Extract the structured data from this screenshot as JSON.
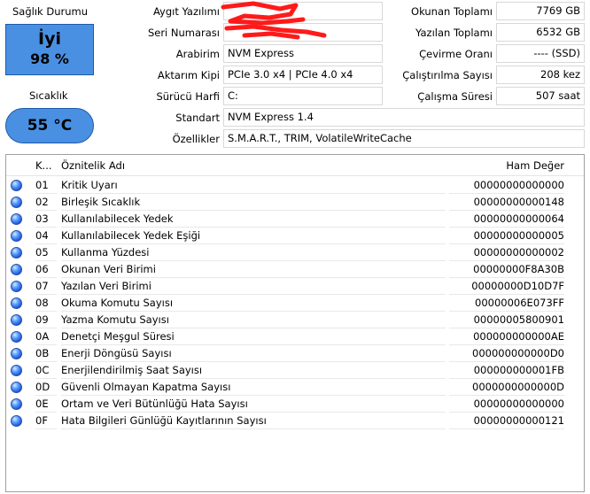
{
  "status": {
    "health_label": "Sağlık Durumu",
    "health_status": "İyi",
    "health_percent": "98 %",
    "temperature_label": "Sıcaklık",
    "temperature_value": "55 °C"
  },
  "info": {
    "firmware_label": "Aygıt Yazılımı",
    "serial_label": "Seri Numarası",
    "interface_label": "Arabirim",
    "interface_value": "NVM Express",
    "transfer_label": "Aktarım Kipi",
    "transfer_value": "PCIe 3.0 x4 | PCIe 4.0 x4",
    "drive_letter_label": "Sürücü Harfi",
    "drive_letter_value": "C:",
    "standard_label": "Standart",
    "standard_value": "NVM Express 1.4",
    "features_label": "Özellikler",
    "features_value": "S.M.A.R.T., TRIM, VolatileWriteCache"
  },
  "stats": {
    "host_reads_label": "Okunan Toplamı",
    "host_reads_value": "7769 GB",
    "host_writes_label": "Yazılan Toplamı",
    "host_writes_value": "6532 GB",
    "rotation_label": "Çevirme Oranı",
    "rotation_value": "---- (SSD)",
    "power_count_label": "Çalıştırılma Sayısı",
    "power_count_value": "208 kez",
    "power_hours_label": "Çalışma Süresi",
    "power_hours_value": "507 saat"
  },
  "colors": {
    "status_fill": "#4a90e2",
    "redaction": "#ff1a1a"
  },
  "table": {
    "headers": {
      "id": "K...",
      "name": "Öznitelik Adı",
      "raw": "Ham Değer"
    },
    "rows": [
      {
        "id": "01",
        "name": "Kritik Uyarı",
        "raw": "00000000000000"
      },
      {
        "id": "02",
        "name": "Birleşik Sıcaklık",
        "raw": "00000000000148"
      },
      {
        "id": "03",
        "name": "Kullanılabilecek Yedek",
        "raw": "00000000000064"
      },
      {
        "id": "04",
        "name": "Kullanılabilecek Yedek Eşiği",
        "raw": "00000000000005"
      },
      {
        "id": "05",
        "name": "Kullanma Yüzdesi",
        "raw": "00000000000002"
      },
      {
        "id": "06",
        "name": "Okunan Veri Birimi",
        "raw": "00000000F8A30B"
      },
      {
        "id": "07",
        "name": "Yazılan Veri Birimi",
        "raw": "00000000D10D7F"
      },
      {
        "id": "08",
        "name": "Okuma Komutu Sayısı",
        "raw": "00000006E073FF"
      },
      {
        "id": "09",
        "name": "Yazma Komutu Sayısı",
        "raw": "00000005800901"
      },
      {
        "id": "0A",
        "name": "Denetçi Meşgul Süresi",
        "raw": "000000000000AE"
      },
      {
        "id": "0B",
        "name": "Enerji Döngüsü Sayısı",
        "raw": "000000000000D0"
      },
      {
        "id": "0C",
        "name": "Enerjilendirilmiş Saat Sayısı",
        "raw": "000000000001FB"
      },
      {
        "id": "0D",
        "name": "Güvenli Olmayan Kapatma Sayısı",
        "raw": "0000000000000D"
      },
      {
        "id": "0E",
        "name": "Ortam ve Veri Bütünlüğü Hata Sayısı",
        "raw": "00000000000000"
      },
      {
        "id": "0F",
        "name": "Hata Bilgileri Günlüğü Kayıtlarının Sayısı",
        "raw": "00000000000121"
      }
    ]
  }
}
